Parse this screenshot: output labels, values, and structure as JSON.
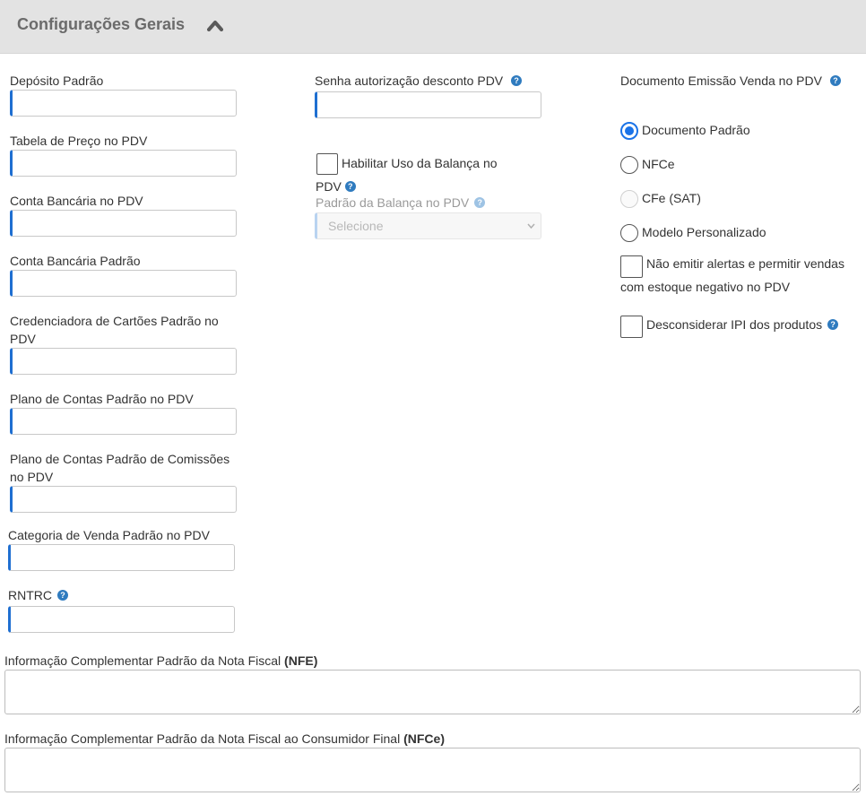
{
  "header": {
    "title": "Configurações Gerais"
  },
  "left_fields": [
    {
      "label": "Depósito Padrão"
    },
    {
      "label": "Tabela de Preço no PDV"
    },
    {
      "label": "Conta Bancária no PDV"
    },
    {
      "label": "Conta Bancária Padrão"
    },
    {
      "label_line1": "Credenciadora de Cartões Padrão no",
      "label_line2": "PDV"
    },
    {
      "label": "Plano de Contas Padrão no PDV"
    },
    {
      "label_line1": "Plano de Contas Padrão de Comissões",
      "label_line2": "no PDV"
    },
    {
      "label": "Categoria de Venda Padrão no PDV"
    },
    {
      "label": "RNTRC"
    }
  ],
  "middle": {
    "senha_label": "Senha autorização desconto PDV",
    "balanca_label_line1": "Habilitar Uso da Balança no",
    "balanca_label_line2": "PDV",
    "padrao_balanca_label": "Padrão da Balança no PDV",
    "padrao_balanca_placeholder": "Selecione"
  },
  "right": {
    "documento_label": "Documento Emissão Venda no PDV",
    "radios": [
      {
        "label": "Documento Padrão",
        "state": "checked"
      },
      {
        "label": "NFCe",
        "state": "unchecked"
      },
      {
        "label": "CFe (SAT)",
        "state": "disabled"
      },
      {
        "label": "Modelo Personalizado",
        "state": "unchecked"
      }
    ],
    "nao_emitir_line1": "Não emitir alertas e permitir vendas",
    "nao_emitir_line2": "com estoque negativo no PDV",
    "desconsiderar_ipi": "Desconsiderar IPI dos produtos"
  },
  "bottom": {
    "nfe_label": "Informação Complementar Padrão da Nota Fiscal ",
    "nfe_bold": "(NFE)",
    "nfce_label": "Informação Complementar Padrão da Nota Fiscal ao Consumidor Final ",
    "nfce_bold": "(NFCe)"
  },
  "icons": {
    "help": "question-circle-icon",
    "collapse": "chevron-up-icon"
  }
}
